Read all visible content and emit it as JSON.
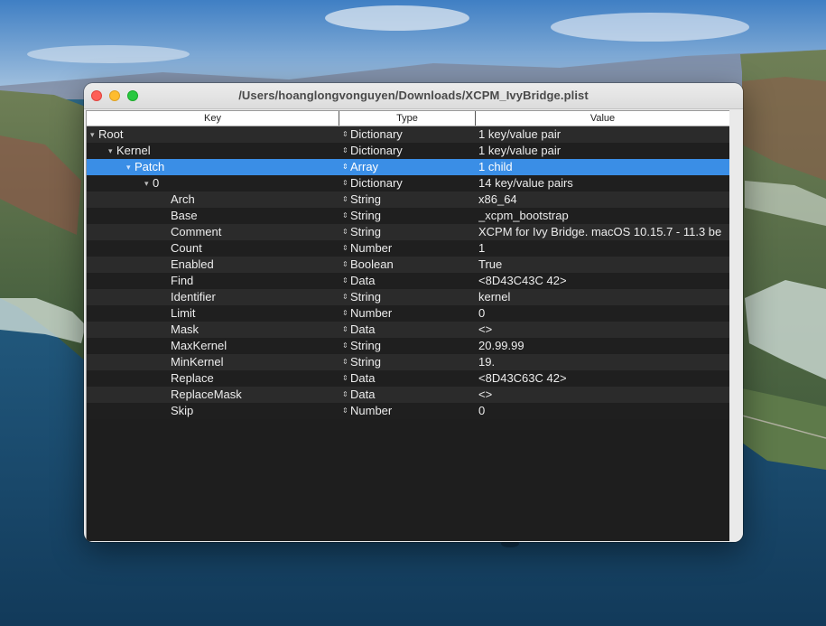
{
  "window": {
    "title": "/Users/hoanglongvonguyen/Downloads/XCPM_IvyBridge.plist"
  },
  "columns": {
    "key": "Key",
    "type": "Type",
    "value": "Value"
  },
  "rows": [
    {
      "key": "Root",
      "type": "Dictionary",
      "value": "1 key/value pair",
      "depth": 0,
      "expanded": true
    },
    {
      "key": "Kernel",
      "type": "Dictionary",
      "value": "1 key/value pair",
      "depth": 1,
      "expanded": true
    },
    {
      "key": "Patch",
      "type": "Array",
      "value": "1 child",
      "depth": 2,
      "expanded": true,
      "selected": true
    },
    {
      "key": "0",
      "type": "Dictionary",
      "value": "14 key/value pairs",
      "depth": 3,
      "expanded": true
    },
    {
      "key": "Arch",
      "type": "String",
      "value": "x86_64",
      "depth": 4
    },
    {
      "key": "Base",
      "type": "String",
      "value": "_xcpm_bootstrap",
      "depth": 4
    },
    {
      "key": "Comment",
      "type": "String",
      "value": "XCPM for Ivy Bridge. macOS 10.15.7 - 11.3 be",
      "depth": 4
    },
    {
      "key": "Count",
      "type": "Number",
      "value": "1",
      "depth": 4
    },
    {
      "key": "Enabled",
      "type": "Boolean",
      "value": "True",
      "depth": 4
    },
    {
      "key": "Find",
      "type": "Data",
      "value": "<8D43C43C 42>",
      "depth": 4
    },
    {
      "key": "Identifier",
      "type": "String",
      "value": "kernel",
      "depth": 4
    },
    {
      "key": "Limit",
      "type": "Number",
      "value": "0",
      "depth": 4
    },
    {
      "key": "Mask",
      "type": "Data",
      "value": "<>",
      "depth": 4
    },
    {
      "key": "MaxKernel",
      "type": "String",
      "value": "20.99.99",
      "depth": 4
    },
    {
      "key": "MinKernel",
      "type": "String",
      "value": "19.",
      "depth": 4
    },
    {
      "key": "Replace",
      "type": "Data",
      "value": "<8D43C63C 42>",
      "depth": 4
    },
    {
      "key": "ReplaceMask",
      "type": "Data",
      "value": "<>",
      "depth": 4
    },
    {
      "key": "Skip",
      "type": "Number",
      "value": "0",
      "depth": 4
    }
  ],
  "icons": {
    "expanded": "▾",
    "type_selector": "⇕"
  },
  "colors": {
    "selection": "#3a8ee6",
    "row_dark": "#1f1f1f",
    "row_alt": "#2b2b2b"
  }
}
